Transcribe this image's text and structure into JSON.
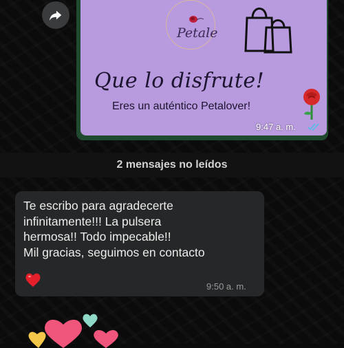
{
  "image_message": {
    "logo_text": "Petale",
    "script_text": "Que lo disfrute!",
    "tagline": "Eres un auténtico Petalover!",
    "time": "9:47 a. m.",
    "read_status": "double-check-read-icon"
  },
  "unread_banner": {
    "text": "2 mensajes no leídos"
  },
  "text_message": {
    "body": "Te escribo para agradecerte\ninfinitamente!!! La pulsera\nhermosa!! Todo impecable!!\nMil gracias, seguimos en contacto",
    "emoji": "red-heart-emoji",
    "time": "9:50 a. m."
  },
  "sticker": {
    "icon": "hearts-sticker"
  },
  "colors": {
    "background": "#0b0b0b",
    "image_bubble_green": "#1f4a2f",
    "card_lavender": "#b89ade",
    "message_bubble": "#262728",
    "read_ticks": "#53bdeb"
  }
}
